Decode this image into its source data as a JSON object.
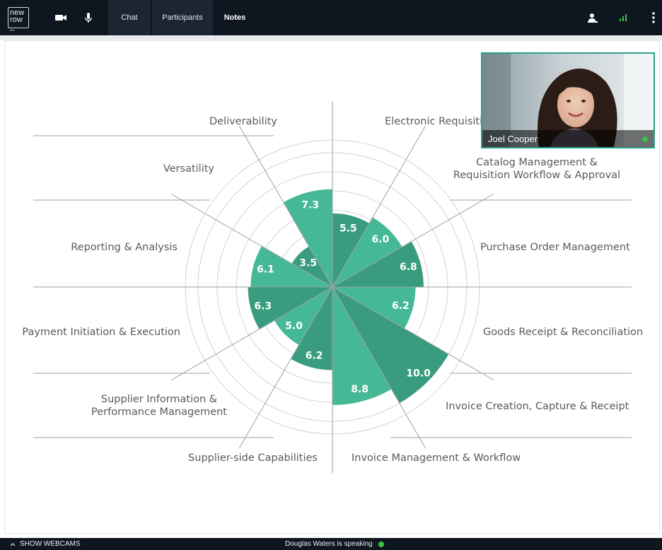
{
  "topbar": {
    "logo": [
      "new",
      "row",
      "_"
    ],
    "tabs": {
      "chat": "Chat",
      "participants": "Participants",
      "notes": "Notes"
    },
    "colors": {
      "background": "#0e1620",
      "active_tab": "#1b2632",
      "signal": "#39c34a"
    }
  },
  "webcam": {
    "name": "Joel Cooper",
    "status_color": "#39c34a"
  },
  "bottombar": {
    "show_webcams": "SHOW WEBCAMS",
    "speaking": "Douglas Waters is speaking"
  },
  "chart_data": {
    "type": "polar-area",
    "max": 10,
    "ring_count": 5,
    "color_light": "#45b996",
    "color_dark": "#3a9c7e",
    "segments": [
      {
        "label": [
          "Electronic Requisitioning"
        ],
        "value": 5.5,
        "label_text": "5.5"
      },
      {
        "label": [
          "Catalog Management &",
          "Requisition Workflow & Approval"
        ],
        "value": 6.0,
        "label_text": "6.0"
      },
      {
        "label": [
          "Purchase Order Management"
        ],
        "value": 6.8,
        "label_text": "6.8"
      },
      {
        "label": [
          "Goods Receipt & Reconciliation"
        ],
        "value": 6.2,
        "label_text": "6.2"
      },
      {
        "label": [
          "Invoice Creation, Capture & Receipt"
        ],
        "value": 10.0,
        "label_text": "10.0"
      },
      {
        "label": [
          "Invoice Management & Workflow"
        ],
        "value": 8.8,
        "label_text": "8.8"
      },
      {
        "label": [
          "Supplier-side Capabilities"
        ],
        "value": 6.2,
        "label_text": "6.2"
      },
      {
        "label": [
          "Supplier Information &",
          "Performance Management"
        ],
        "value": 5.0,
        "label_text": "5.0"
      },
      {
        "label": [
          "Payment Initiation & Execution"
        ],
        "value": 6.3,
        "label_text": "6.3"
      },
      {
        "label": [
          "Reporting & Analysis"
        ],
        "value": 6.1,
        "label_text": "6.1"
      },
      {
        "label": [
          "Versatility"
        ],
        "value": 3.5,
        "label_text": "3.5"
      },
      {
        "label": [
          "Deliverability"
        ],
        "value": 7.3,
        "label_text": "7.3"
      }
    ]
  }
}
